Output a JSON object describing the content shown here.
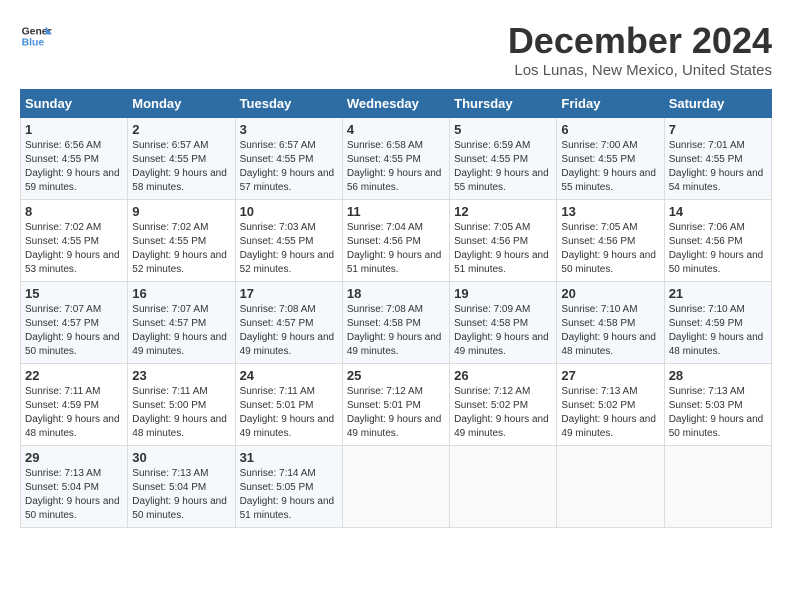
{
  "header": {
    "logo_line1": "General",
    "logo_line2": "Blue",
    "title": "December 2024",
    "subtitle": "Los Lunas, New Mexico, United States"
  },
  "weekdays": [
    "Sunday",
    "Monday",
    "Tuesday",
    "Wednesday",
    "Thursday",
    "Friday",
    "Saturday"
  ],
  "weeks": [
    [
      {
        "day": "1",
        "sunrise": "6:56 AM",
        "sunset": "4:55 PM",
        "daylight": "9 hours and 59 minutes."
      },
      {
        "day": "2",
        "sunrise": "6:57 AM",
        "sunset": "4:55 PM",
        "daylight": "9 hours and 58 minutes."
      },
      {
        "day": "3",
        "sunrise": "6:57 AM",
        "sunset": "4:55 PM",
        "daylight": "9 hours and 57 minutes."
      },
      {
        "day": "4",
        "sunrise": "6:58 AM",
        "sunset": "4:55 PM",
        "daylight": "9 hours and 56 minutes."
      },
      {
        "day": "5",
        "sunrise": "6:59 AM",
        "sunset": "4:55 PM",
        "daylight": "9 hours and 55 minutes."
      },
      {
        "day": "6",
        "sunrise": "7:00 AM",
        "sunset": "4:55 PM",
        "daylight": "9 hours and 55 minutes."
      },
      {
        "day": "7",
        "sunrise": "7:01 AM",
        "sunset": "4:55 PM",
        "daylight": "9 hours and 54 minutes."
      }
    ],
    [
      {
        "day": "8",
        "sunrise": "7:02 AM",
        "sunset": "4:55 PM",
        "daylight": "9 hours and 53 minutes."
      },
      {
        "day": "9",
        "sunrise": "7:02 AM",
        "sunset": "4:55 PM",
        "daylight": "9 hours and 52 minutes."
      },
      {
        "day": "10",
        "sunrise": "7:03 AM",
        "sunset": "4:55 PM",
        "daylight": "9 hours and 52 minutes."
      },
      {
        "day": "11",
        "sunrise": "7:04 AM",
        "sunset": "4:56 PM",
        "daylight": "9 hours and 51 minutes."
      },
      {
        "day": "12",
        "sunrise": "7:05 AM",
        "sunset": "4:56 PM",
        "daylight": "9 hours and 51 minutes."
      },
      {
        "day": "13",
        "sunrise": "7:05 AM",
        "sunset": "4:56 PM",
        "daylight": "9 hours and 50 minutes."
      },
      {
        "day": "14",
        "sunrise": "7:06 AM",
        "sunset": "4:56 PM",
        "daylight": "9 hours and 50 minutes."
      }
    ],
    [
      {
        "day": "15",
        "sunrise": "7:07 AM",
        "sunset": "4:57 PM",
        "daylight": "9 hours and 50 minutes."
      },
      {
        "day": "16",
        "sunrise": "7:07 AM",
        "sunset": "4:57 PM",
        "daylight": "9 hours and 49 minutes."
      },
      {
        "day": "17",
        "sunrise": "7:08 AM",
        "sunset": "4:57 PM",
        "daylight": "9 hours and 49 minutes."
      },
      {
        "day": "18",
        "sunrise": "7:08 AM",
        "sunset": "4:58 PM",
        "daylight": "9 hours and 49 minutes."
      },
      {
        "day": "19",
        "sunrise": "7:09 AM",
        "sunset": "4:58 PM",
        "daylight": "9 hours and 49 minutes."
      },
      {
        "day": "20",
        "sunrise": "7:10 AM",
        "sunset": "4:58 PM",
        "daylight": "9 hours and 48 minutes."
      },
      {
        "day": "21",
        "sunrise": "7:10 AM",
        "sunset": "4:59 PM",
        "daylight": "9 hours and 48 minutes."
      }
    ],
    [
      {
        "day": "22",
        "sunrise": "7:11 AM",
        "sunset": "4:59 PM",
        "daylight": "9 hours and 48 minutes."
      },
      {
        "day": "23",
        "sunrise": "7:11 AM",
        "sunset": "5:00 PM",
        "daylight": "9 hours and 48 minutes."
      },
      {
        "day": "24",
        "sunrise": "7:11 AM",
        "sunset": "5:01 PM",
        "daylight": "9 hours and 49 minutes."
      },
      {
        "day": "25",
        "sunrise": "7:12 AM",
        "sunset": "5:01 PM",
        "daylight": "9 hours and 49 minutes."
      },
      {
        "day": "26",
        "sunrise": "7:12 AM",
        "sunset": "5:02 PM",
        "daylight": "9 hours and 49 minutes."
      },
      {
        "day": "27",
        "sunrise": "7:13 AM",
        "sunset": "5:02 PM",
        "daylight": "9 hours and 49 minutes."
      },
      {
        "day": "28",
        "sunrise": "7:13 AM",
        "sunset": "5:03 PM",
        "daylight": "9 hours and 50 minutes."
      }
    ],
    [
      {
        "day": "29",
        "sunrise": "7:13 AM",
        "sunset": "5:04 PM",
        "daylight": "9 hours and 50 minutes."
      },
      {
        "day": "30",
        "sunrise": "7:13 AM",
        "sunset": "5:04 PM",
        "daylight": "9 hours and 50 minutes."
      },
      {
        "day": "31",
        "sunrise": "7:14 AM",
        "sunset": "5:05 PM",
        "daylight": "9 hours and 51 minutes."
      },
      null,
      null,
      null,
      null
    ]
  ],
  "labels": {
    "sunrise": "Sunrise:",
    "sunset": "Sunset:",
    "daylight": "Daylight:"
  }
}
